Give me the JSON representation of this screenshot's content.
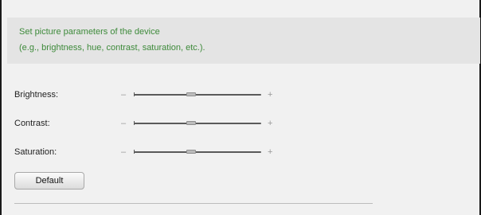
{
  "info": {
    "line1": "Set picture parameters of the device",
    "line2": "(e.g., brightness, hue, contrast, saturation, etc.)."
  },
  "sliders": [
    {
      "label": "Brightness:",
      "minus": "–",
      "plus": "+",
      "value_fraction": 0.45
    },
    {
      "label": "Contrast:",
      "minus": "–",
      "plus": "+",
      "value_fraction": 0.45
    },
    {
      "label": "Saturation:",
      "minus": "–",
      "plus": "+",
      "value_fraction": 0.45
    }
  ],
  "buttons": {
    "default_label": "Default"
  },
  "colors": {
    "info_text": "#3d8a3a",
    "panel_background": "#f1f1f1",
    "info_background": "#e4e4e4"
  }
}
